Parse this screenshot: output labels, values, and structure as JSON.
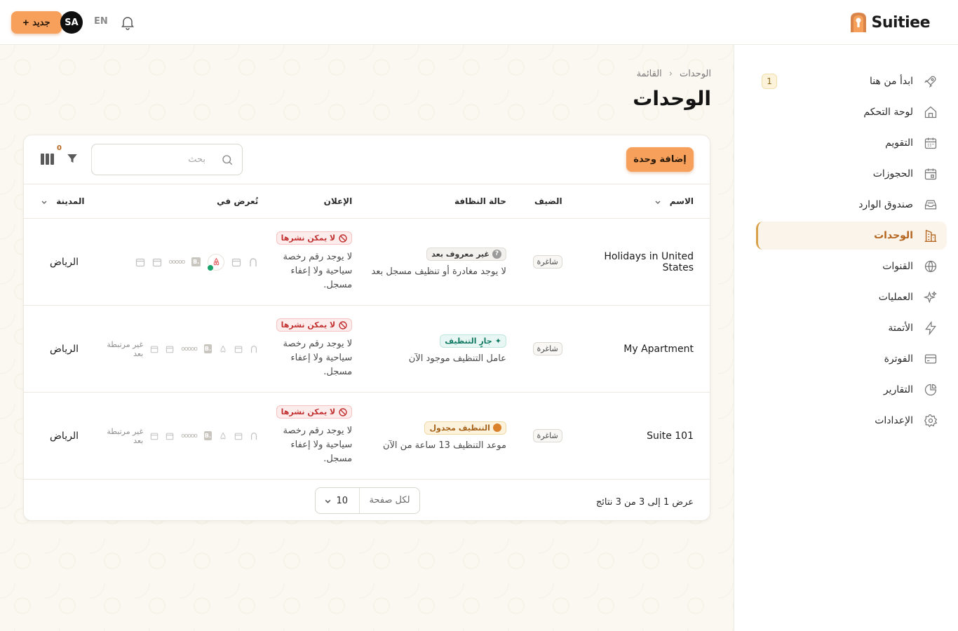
{
  "topbar": {
    "brand": "Suitiee",
    "new_button": "جديد",
    "avatar_initials": "SA",
    "language": "EN"
  },
  "sidebar": {
    "items": [
      {
        "label": "ابدأ من هنا",
        "icon": "rocket-icon",
        "badge": "1",
        "active": false
      },
      {
        "label": "لوحة التحكم",
        "icon": "home-icon",
        "active": false
      },
      {
        "label": "التقويم",
        "icon": "calendar-icon",
        "active": false
      },
      {
        "label": "الحجوزات",
        "icon": "bookings-calendar-icon",
        "active": false
      },
      {
        "label": "صندوق الوارد",
        "icon": "inbox-icon",
        "active": false
      },
      {
        "label": "الوحدات",
        "icon": "building-icon",
        "active": true
      },
      {
        "label": "القنوات",
        "icon": "globe-icon",
        "active": false
      },
      {
        "label": "العمليات",
        "icon": "sparkles-icon",
        "active": false
      },
      {
        "label": "الأتمتة",
        "icon": "lightning-icon",
        "active": false
      },
      {
        "label": "الفوترة",
        "icon": "billing-icon",
        "active": false
      },
      {
        "label": "التقارير",
        "icon": "pie-chart-icon",
        "active": false
      },
      {
        "label": "الإعدادات",
        "icon": "settings-icon",
        "active": false
      }
    ]
  },
  "breadcrumb": {
    "root": "الوحدات",
    "current": "القائمة"
  },
  "page": {
    "title": "الوحدات"
  },
  "toolbar": {
    "add_unit": "إضافة وحدة",
    "search_placeholder": "بحث",
    "filter_count": "0"
  },
  "table": {
    "headers": {
      "name": "الاسم",
      "guest": "الضيف",
      "cleaning": "حالة النظافة",
      "listing": "الإعلان",
      "shown_on": "تُعرض في",
      "city": "المدينة"
    },
    "rows": [
      {
        "name": "Holidays in United States",
        "guest": "شاغرة",
        "cleaning_status": "غير معروف بعد",
        "cleaning_kind": "unknown",
        "cleaning_desc": "لا يوجد مغادرة أو تنظيف مسجل بعد",
        "listing_status": "لا يمكن نشرها",
        "listing_desc": "لا يوجد رقم رخصة سياحية ولا إعفاء مسجل.",
        "linked": true,
        "not_linked_text": "",
        "city": "الرياض"
      },
      {
        "name": "My Apartment",
        "guest": "شاغرة",
        "cleaning_status": "جارٍ التنظيف",
        "cleaning_kind": "active",
        "cleaning_desc": "عامل التنظيف موجود الآن",
        "listing_status": "لا يمكن نشرها",
        "listing_desc": "لا يوجد رقم رخصة سياحية ولا إعفاء مسجل.",
        "linked": false,
        "not_linked_text": "غير مرتبطة بعد",
        "city": "الرياض"
      },
      {
        "name": "Suite 101",
        "guest": "شاغرة",
        "cleaning_status": "التنظيف مجدول",
        "cleaning_kind": "scheduled",
        "cleaning_desc": "موعد التنظيف 13 ساعة من الآن",
        "listing_status": "لا يمكن نشرها",
        "listing_desc": "لا يوجد رقم رخصة سياحية ولا إعفاء مسجل.",
        "linked": false,
        "not_linked_text": "غير مرتبطة بعد",
        "city": "الرياض"
      }
    ]
  },
  "footer": {
    "results_text": "عرض 1 إلى 3 من 3 نتائج",
    "per_page_label": "لكل صفحة",
    "per_page_value": "10"
  },
  "colors": {
    "accent": "#f6a05c",
    "active_nav": "#b4651f",
    "danger": "#c33232",
    "success": "#117a63"
  }
}
